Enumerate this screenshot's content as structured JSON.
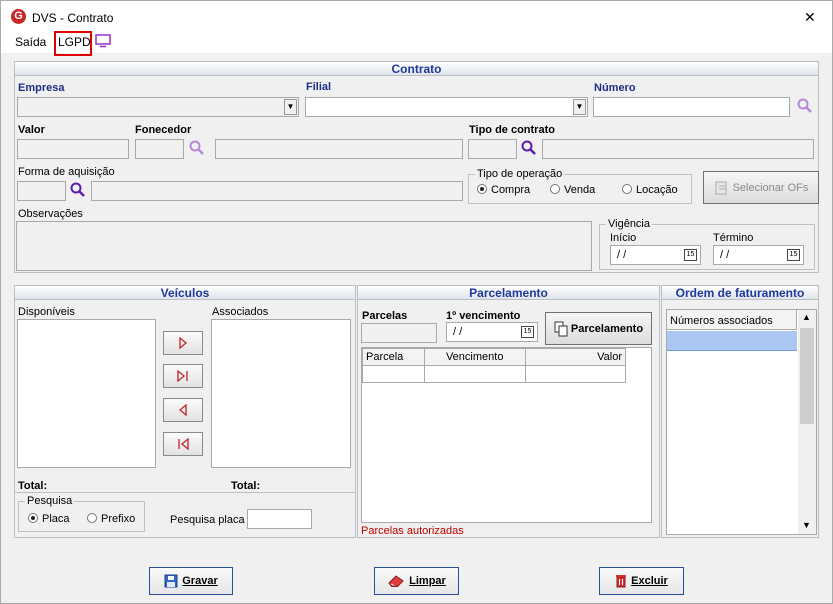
{
  "window": {
    "title": "DVS - Contrato",
    "close_glyph": "✕"
  },
  "menu": {
    "items": [
      "Saída",
      "LGPD"
    ]
  },
  "contrato": {
    "section_title": "Contrato",
    "empresa_label": "Empresa",
    "filial_label": "Filial",
    "numero_label": "Número",
    "valor_label": "Valor",
    "fornecedor_label": "Fonecedor",
    "tipo_contrato_label": "Tipo de contrato",
    "forma_aquisicao_label": "Forma de aquisição",
    "tipo_operacao": {
      "label": "Tipo de operação",
      "options": [
        "Compra",
        "Venda",
        "Locação"
      ],
      "selected": "Compra"
    },
    "selecionar_ofs": "Selecionar OFs",
    "observacoes_label": "Observações",
    "vigencia": {
      "label": "Vigência",
      "inicio_label": "Início",
      "termino_label": "Término",
      "inicio_value": "/ /",
      "termino_value": "/ /"
    },
    "calendar_glyph": "15"
  },
  "veiculos": {
    "section_title": "Veículos",
    "disponiveis_label": "Disponíveis",
    "associados_label": "Associados",
    "total_left": "Total:",
    "total_right": "Total:",
    "pesquisa": {
      "label": "Pesquisa",
      "options": [
        "Placa",
        "Prefixo"
      ],
      "selected": "Placa"
    },
    "pesquisa_placa_label": "Pesquisa placa"
  },
  "parcelamento": {
    "section_title": "Parcelamento",
    "parcelas_label": "Parcelas",
    "vencimento_label": "1º vencimento",
    "vencimento_value": "/ /",
    "button_label": "Parcelamento",
    "columns": [
      "Parcela",
      "Vencimento",
      "Valor"
    ],
    "footer_note": "Parcelas autorizadas"
  },
  "ordem": {
    "section_title": "Ordem de faturamento",
    "column": "Números associados"
  },
  "actions": {
    "gravar": "Gravar",
    "limpar": "Limpar",
    "excluir": "Excluir"
  },
  "colors": {
    "accent": "#1e3a9a",
    "highlight_row": "#aac7f2",
    "note_red": "#c00000",
    "lgpd_border": "#e00000"
  }
}
